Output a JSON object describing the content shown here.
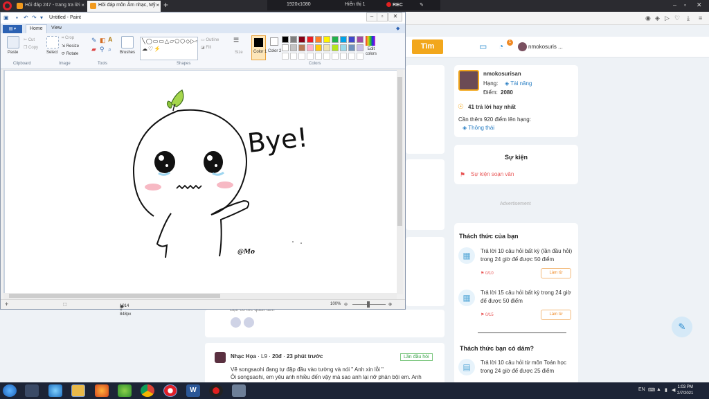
{
  "browser": {
    "tabs": [
      {
        "label": "Hỏi đáp 247 - trang tra lời"
      },
      {
        "label": "Hỏi đáp môn Âm nhạc, Mỹ"
      }
    ],
    "recorder": {
      "resolution": "1920x1080",
      "screen": "Hiển thị 1",
      "rec": "REC"
    }
  },
  "site": {
    "search_button": "Tìm",
    "notifications_count": "1",
    "username_short": "nmokosuris ..."
  },
  "profile": {
    "username": "nmokosurisan",
    "rank_label": "Hạng:",
    "rank_value": "Tài năng",
    "points_label": "Điểm:",
    "points_value": "2080",
    "best_answers": "41 trả lời hay nhất",
    "next_rank": "Cần thêm 920 điểm lên hạng:",
    "next_rank_name": "Thông thái"
  },
  "events": {
    "title": "Sự kiện",
    "item": "Sự kiện soạn văn"
  },
  "advertisement": "Advertisement",
  "challenges": {
    "title": "Thách thức của bạn",
    "items": [
      {
        "line1": "Trả lời 10 câu hỏi  bất kỳ (lần đầu hỏi)",
        "line2": "trong 24 giờ để được 50 điểm",
        "count": "0/10",
        "button": "Làm từ"
      },
      {
        "line1": "Trả lời 15 câu hỏi  bất kỳ  trong 24 giờ",
        "line2": "để được 50 điểm",
        "count": "0/15",
        "button": "Làm từ"
      }
    ],
    "dare_title": "Thách thức bạn có dám?",
    "dare_line1": "Trả lời 10 câu hỏi  từ môn Toán học",
    "dare_line2": "trong 24 giờ để được 25 điểm"
  },
  "post": {
    "author": "Nhạc Họa",
    "level": "L9",
    "age": "20đ",
    "time": "23 phút trước",
    "tag": "Lần đầu hỏi",
    "line1": "Vẽ songsaohi đang tự đập đầu vào tường và nói \" Anh xin lỗi \"",
    "line2": "Ôi songsaohi, em yêu anh nhiều đến vậy mà sao anh lại nỡ phản bội em. Anh",
    "prev_snip": "Bạn có thể quan tâm"
  },
  "paint": {
    "title": "Untitled - Paint",
    "file_tab": "▾",
    "tabs": [
      "Home",
      "View"
    ],
    "clipboard": {
      "paste": "Paste",
      "cut": "Cut",
      "copy": "Copy",
      "label": "Clipboard"
    },
    "image": {
      "crop": "Crop",
      "resize": "Resize",
      "rotate": "Rotate",
      "select": "Select",
      "label": "Image"
    },
    "tools_label": "Tools",
    "brushes": "Brushes",
    "shapes": {
      "outline": "Outline",
      "fill": "Fill",
      "label": "Shapes"
    },
    "size": "Size",
    "color1": "Color 1",
    "color2": "Color 2",
    "edit_colors": "Edit colors",
    "colors_label": "Colors",
    "palette": [
      "#000000",
      "#7f7f7f",
      "#880015",
      "#ed1c24",
      "#ff7f27",
      "#fff200",
      "#22b14c",
      "#00a2e8",
      "#3f48cc",
      "#a349a4",
      "#ffffff",
      "#c3c3c3",
      "#b97a57",
      "#ffaec9",
      "#ffc90e",
      "#efe4b0",
      "#b5e61d",
      "#99d9ea",
      "#7092be",
      "#c8bfe7"
    ],
    "drawing": {
      "text": "Bye!",
      "signature": "@Mo"
    },
    "status": {
      "size": "1014 × 848px",
      "zoom": "100%"
    }
  },
  "taskbar": {
    "time": "1:03 PM",
    "date": "2/7/2021",
    "lang": "EN"
  }
}
